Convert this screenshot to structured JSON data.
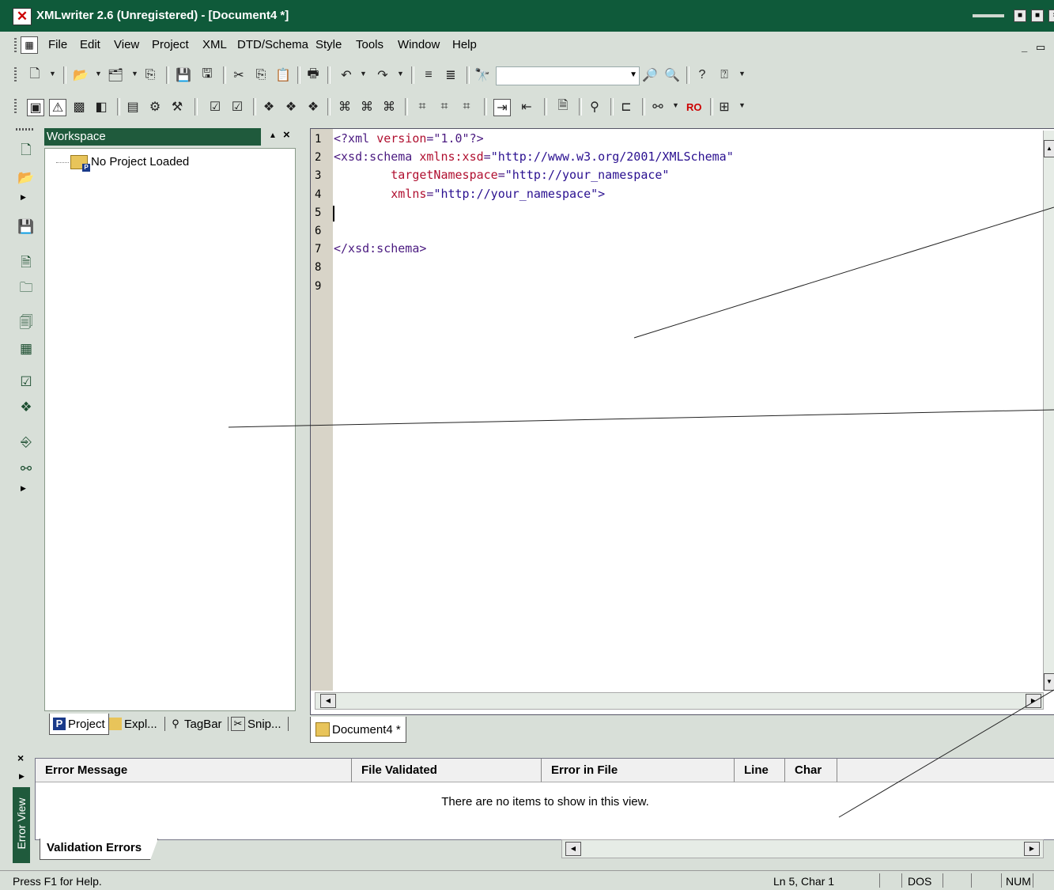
{
  "window": {
    "title": "XMLwriter 2.6 (Unregistered) - [Document4 *]",
    "app_icon": "xmlwriter-logo-icon"
  },
  "menu": [
    {
      "label": "File"
    },
    {
      "label": "Edit"
    },
    {
      "label": "View"
    },
    {
      "label": "Project"
    },
    {
      "label": "XML"
    },
    {
      "label": "DTD/Schema"
    },
    {
      "label": "Style"
    },
    {
      "label": "Tools"
    },
    {
      "label": "Window"
    },
    {
      "label": "Help"
    }
  ],
  "toolbar": {
    "find_text": "",
    "row1_icons": [
      "new-document-icon",
      "open-folder-icon",
      "open-project-icon",
      "recent-project-icon",
      "save-icon",
      "save-all-icon",
      "cut-icon",
      "copy-icon",
      "paste-icon",
      "print-icon",
      "undo-icon",
      "redo-icon",
      "indent-icon",
      "outdent-icon",
      "find-icon",
      "find-next-icon",
      "find-replace-icon",
      "context-help-icon",
      "help-icon"
    ],
    "row2_ro_label": "RO"
  },
  "workspace": {
    "title": "Workspace",
    "tree_root": "No Project Loaded",
    "tabs": [
      {
        "label": "Project",
        "icon": "project-tab-icon"
      },
      {
        "label": "Expl...",
        "icon": "explorer-folder-icon"
      },
      {
        "label": "TagBar",
        "icon": "tagbar-icon"
      },
      {
        "label": "Snip...",
        "icon": "snippets-icon"
      }
    ]
  },
  "editor": {
    "line_numbers": [
      "1",
      "2",
      "3",
      "4",
      "5",
      "6",
      "7",
      "8",
      "9"
    ],
    "lines": [
      [
        {
          "t": "<?xml ",
          "c": "br"
        },
        {
          "t": "version",
          "c": "at"
        },
        {
          "t": "=\"1.0\"?>",
          "c": "br"
        }
      ],
      [
        {
          "t": "<xsd:schema ",
          "c": "br"
        },
        {
          "t": "xmlns:xsd",
          "c": "at"
        },
        {
          "t": "=",
          "c": "br"
        },
        {
          "t": "\"http://www.w3.org/2001/XMLSchema\"",
          "c": "st"
        }
      ],
      [
        {
          "t": "        ",
          "c": "br"
        },
        {
          "t": "targetNamespace",
          "c": "at"
        },
        {
          "t": "=",
          "c": "br"
        },
        {
          "t": "\"http://your_namespace\"",
          "c": "st"
        }
      ],
      [
        {
          "t": "        ",
          "c": "br"
        },
        {
          "t": "xmlns",
          "c": "at"
        },
        {
          "t": "=",
          "c": "br"
        },
        {
          "t": "\"http://your_namespace\">",
          "c": "st"
        }
      ],
      [],
      [],
      [
        {
          "t": "</xsd:schema>",
          "c": "br"
        }
      ],
      [],
      []
    ],
    "doc_tab": "Document4 *"
  },
  "error_view": {
    "side_label": "Error View",
    "columns": [
      "Error Message",
      "File Validated",
      "Error in File",
      "Line",
      "Char"
    ],
    "empty_message": "There are no items to show in this view.",
    "tab": "Validation Errors"
  },
  "status": {
    "help": "Press F1 for Help.",
    "position": "Ln 5, Char 1",
    "line_ending": "DOS",
    "num": "NUM"
  }
}
